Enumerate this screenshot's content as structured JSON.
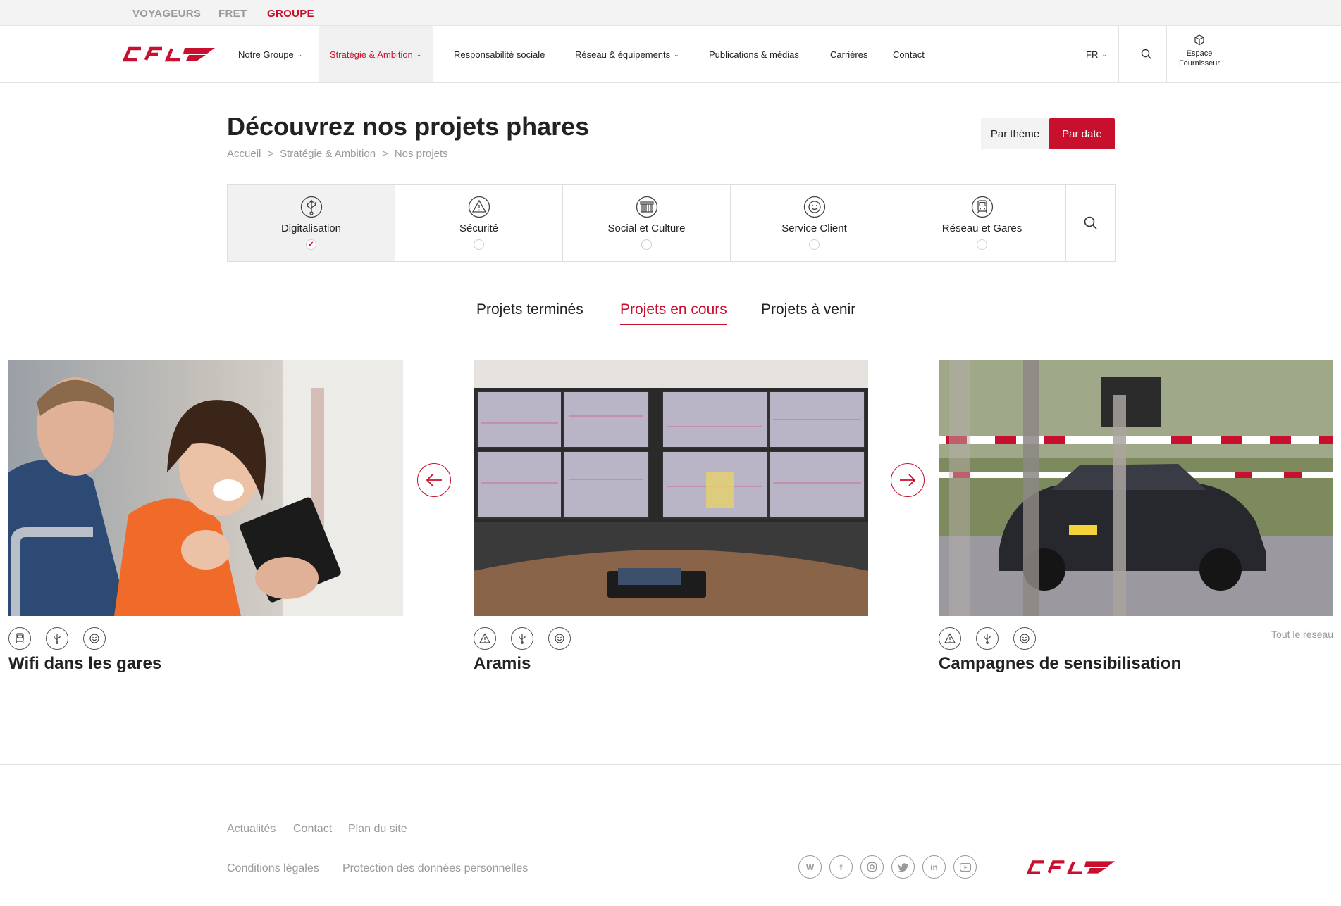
{
  "topbar": {
    "items": [
      {
        "label": "VOYAGEURS",
        "active": false
      },
      {
        "label": "FRET",
        "active": false
      },
      {
        "label": "GROUPE",
        "active": true
      }
    ]
  },
  "header": {
    "logo_text": "CFL",
    "nav": [
      {
        "label": "Notre Groupe",
        "dropdown": true
      },
      {
        "label": "Stratégie & Ambition",
        "dropdown": true,
        "active": true
      },
      {
        "label": "Responsabilité sociale",
        "dropdown": false
      },
      {
        "label": "Réseau & équipements",
        "dropdown": true
      },
      {
        "label": "Publications & médias",
        "dropdown": false
      },
      {
        "label": "Carrières",
        "dropdown": false
      },
      {
        "label": "Contact",
        "dropdown": false
      }
    ],
    "language": "FR",
    "supplier_line1": "Espace",
    "supplier_line2": "Fournisseur"
  },
  "page": {
    "title": "Découvrez nos projets phares",
    "breadcrumb": [
      "Accueil",
      "Stratégie & Ambition",
      "Nos projets"
    ],
    "breadcrumb_sep": ">",
    "view_toggle": {
      "theme": "Par thème",
      "date": "Par date",
      "selected": "date"
    }
  },
  "categories": [
    {
      "label": "Digitalisation",
      "icon": "usb-icon",
      "selected": true
    },
    {
      "label": "Sécurité",
      "icon": "warning-icon",
      "selected": false
    },
    {
      "label": "Social et Culture",
      "icon": "theatre-icon",
      "selected": false
    },
    {
      "label": "Service Client",
      "icon": "smiley-icon",
      "selected": false
    },
    {
      "label": "Réseau et Gares",
      "icon": "train-icon",
      "selected": false
    }
  ],
  "tabs": [
    {
      "label": "Projets terminés",
      "active": false
    },
    {
      "label": "Projets en cours",
      "active": true
    },
    {
      "label": "Projets à venir",
      "active": false
    }
  ],
  "projects": [
    {
      "title": "Wifi dans les gares",
      "tags": [
        "train-icon",
        "usb-icon",
        "smiley-icon"
      ],
      "image": "people-with-tablet-photo"
    },
    {
      "title": "Aramis",
      "tags": [
        "warning-icon",
        "usb-icon",
        "smiley-icon"
      ],
      "image": "control-room-screens-photo"
    },
    {
      "title": "Campagnes de sensibilisation",
      "tags": [
        "warning-icon",
        "usb-icon",
        "smiley-icon"
      ],
      "image": "car-at-level-crossing-photo",
      "aux_label": "Tout le réseau"
    }
  ],
  "footer": {
    "links_row1": [
      "Actualités",
      "Contact",
      "Plan du site"
    ],
    "links_row2": [
      "Conditions légales",
      "Protection des données personnelles"
    ],
    "social": [
      "wordpress-icon",
      "facebook-icon",
      "instagram-icon",
      "twitter-icon",
      "linkedin-icon",
      "youtube-icon"
    ],
    "logo_text": "CFL"
  },
  "colors": {
    "brand_red": "#c8102e",
    "muted": "#9a9a9a"
  }
}
